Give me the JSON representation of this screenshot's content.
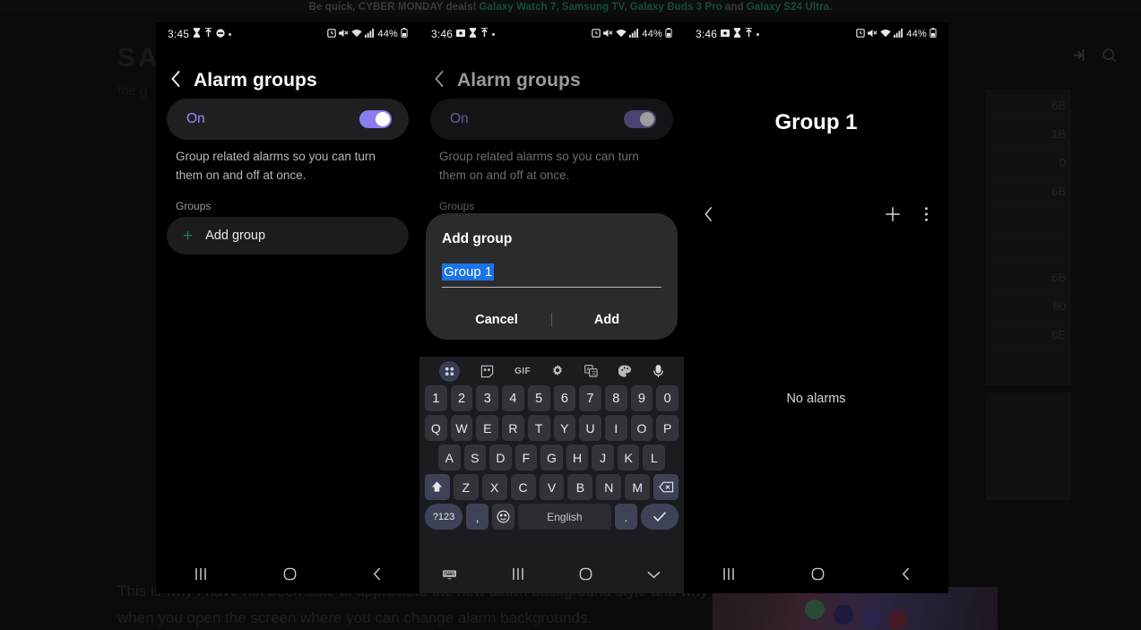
{
  "background": {
    "promo": {
      "prefix": "Be quick, CYBER MONDAY deals!",
      "links": [
        "Galaxy Watch 7,",
        "Samsung TV,",
        "Galaxy Buds 3 Pro"
      ],
      "conjunction": "and",
      "last_link": "Galaxy S24 Ultra."
    },
    "logo": "SAMSUNG",
    "icons": [
      "login-icon",
      "search-icon"
    ],
    "snippet_top": "the g",
    "paragraph": "This is why I have not been able to appreciate the new alarm background style and why it crashes when you open the screen where you can change alarm backgrounds.",
    "table_values": [
      "6B",
      "1B",
      "0",
      "6B",
      "",
      "",
      "6B",
      "60",
      "6E"
    ]
  },
  "panels": [
    {
      "id": "panel-1",
      "status": {
        "time": "3:45",
        "battery": "44%"
      },
      "appbar": {
        "back": "back-arrow-icon",
        "title": "Alarm groups"
      },
      "toggle": {
        "label": "On",
        "state": "on"
      },
      "description": "Group related alarms so you can turn them on and off at once.",
      "section_label": "Groups",
      "add_group": {
        "plus": "+",
        "label": "Add group"
      },
      "navbar": [
        "recents-icon",
        "home-icon",
        "back-icon"
      ]
    },
    {
      "id": "panel-2",
      "status": {
        "time": "3:46",
        "battery": "44%"
      },
      "appbar": {
        "back": "back-arrow-icon",
        "title": "Alarm groups"
      },
      "toggle": {
        "label": "On",
        "state": "on"
      },
      "description": "Group related alarms so you can turn them on and off at once.",
      "section_label": "Groups",
      "dialog": {
        "title": "Add group",
        "input_value": "Group 1",
        "cancel": "Cancel",
        "confirm": "Add"
      },
      "keyboard": {
        "toolbar": [
          "keyboard-modes-icon",
          "sticker-icon",
          "GIF",
          "settings-icon",
          "translate-icon",
          "theme-icon",
          "microphone-icon"
        ],
        "rows": [
          [
            "1",
            "2",
            "3",
            "4",
            "5",
            "6",
            "7",
            "8",
            "9",
            "0"
          ],
          [
            "Q",
            "W",
            "E",
            "R",
            "T",
            "Y",
            "U",
            "I",
            "O",
            "P"
          ],
          [
            "A",
            "S",
            "D",
            "F",
            "G",
            "H",
            "J",
            "K",
            "L"
          ],
          [
            "shift-icon",
            "Z",
            "X",
            "C",
            "V",
            "B",
            "N",
            "M",
            "backspace-icon"
          ],
          [
            "?123",
            ",",
            "emoji-icon",
            "English",
            ".",
            "enter-icon"
          ]
        ],
        "space_label": "English",
        "symbols_label": "?123"
      },
      "navbar": [
        "hide-keyboard-icon",
        "recents-icon",
        "home-icon",
        "chevron-down-icon"
      ]
    },
    {
      "id": "panel-3",
      "status": {
        "time": "3:46",
        "battery": "44%"
      },
      "title": "Group 1",
      "toolbar": {
        "back": "back-arrow-icon",
        "add": "plus-icon",
        "more": "more-vertical-icon"
      },
      "empty_state": "No alarms",
      "navbar": [
        "recents-icon",
        "home-icon",
        "back-icon"
      ]
    }
  ],
  "colors": {
    "toggle_on": "#8b7cf0",
    "toggle_label": "#9b8cf5",
    "plus_green": "#1f7a5a",
    "selection_blue": "#1a73e8",
    "dialog_bg": "#2b2b2d",
    "keyboard_bg": "#1b1b20"
  }
}
